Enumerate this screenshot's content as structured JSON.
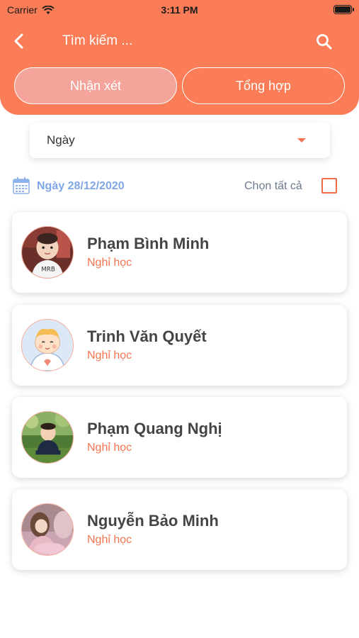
{
  "status_bar": {
    "carrier": "Carrier",
    "time": "3:11 PM"
  },
  "header": {
    "search_placeholder": "Tìm kiếm ...",
    "tabs": [
      {
        "label": "Nhận xét",
        "active": true
      },
      {
        "label": "Tổng hợp",
        "active": false
      }
    ]
  },
  "filter": {
    "selected": "Ngày"
  },
  "date_row": {
    "date_label": "Ngày 28/12/2020",
    "select_all_label": "Chọn tất cả",
    "select_all_checked": false
  },
  "students": [
    {
      "name": "Phạm Bình Minh",
      "status": "Nghỉ học",
      "avatar": "photo-baby-icon"
    },
    {
      "name": "Trinh Văn Quyết",
      "status": "Nghỉ học",
      "avatar": "cartoon-baby-icon"
    },
    {
      "name": "Phạm Quang Nghị",
      "status": "Nghỉ học",
      "avatar": "photo-baby-outdoor-icon"
    },
    {
      "name": "Nguyễn Bảo Minh",
      "status": "Nghỉ học",
      "avatar": "photo-girl-icon"
    }
  ],
  "colors": {
    "accent": "#fb7d57",
    "status_text": "#f4744f",
    "date_text": "#7fa6e6"
  }
}
